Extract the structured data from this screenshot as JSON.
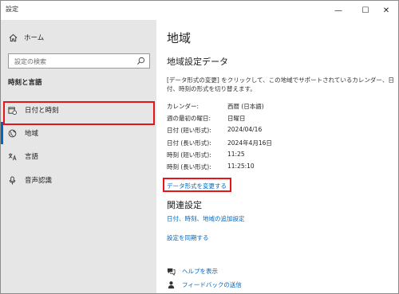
{
  "window": {
    "title": "設定",
    "min_glyph": "—",
    "max_glyph": "☐",
    "close_glyph": "✕"
  },
  "sidebar": {
    "home_label": "ホーム",
    "search_placeholder": "設定の検索",
    "section_title": "時刻と言語",
    "items": [
      {
        "id": "datetime",
        "label": "日付と時刻",
        "icon": "calendar-clock-icon"
      },
      {
        "id": "region",
        "label": "地域",
        "icon": "globe-icon",
        "selected": true
      },
      {
        "id": "language",
        "label": "言語",
        "icon": "language-icon"
      },
      {
        "id": "speech",
        "label": "音声認識",
        "icon": "microphone-icon"
      }
    ]
  },
  "main": {
    "title": "地域",
    "format_heading": "地域設定データ",
    "description": "[データ形式の変更] をクリックして、この地域でサポートされているカレンダー、日付、時刻の形式を切り替えます。",
    "formats": [
      {
        "key": "カレンダー:",
        "value": "西暦 (日本語)"
      },
      {
        "key": "週の最初の曜日:",
        "value": "日曜日"
      },
      {
        "key": "日付 (短い形式):",
        "value": "2024/04/16"
      },
      {
        "key": "日付 (長い形式):",
        "value": "2024年4月16日"
      },
      {
        "key": "時刻 (短い形式):",
        "value": "11:25"
      },
      {
        "key": "時刻 (長い形式):",
        "value": "11:25:10"
      }
    ],
    "change_link": "データ形式を変更する",
    "related_heading": "関連設定",
    "related_links": [
      "日付、時刻、地域の追加設定",
      "設定を同期する"
    ],
    "help_links": [
      "ヘルプを表示",
      "フィードバックの送信"
    ]
  },
  "colors": {
    "accent": "#0067c0",
    "highlight": "#e8141b",
    "sidebar_bg": "#e6e6e6"
  }
}
